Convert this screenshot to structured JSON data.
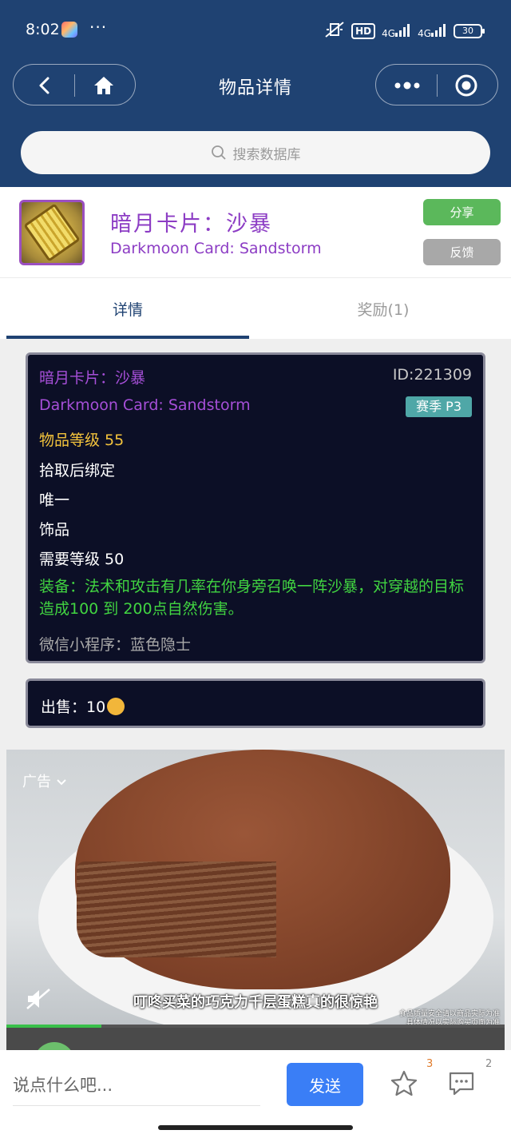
{
  "status_bar": {
    "time": "8:02",
    "more": "···",
    "hd": "HD",
    "signal1": "4G",
    "signal2": "4G",
    "battery": "30"
  },
  "nav": {
    "title": "物品详情"
  },
  "search": {
    "placeholder": "搜索数据库"
  },
  "item": {
    "name_cn": "暗月卡片：沙暴",
    "name_en": "Darkmoon Card: Sandstorm",
    "share_label": "分享",
    "feedback_label": "反馈",
    "border_color": "#9b4fc0",
    "name_color": "#8c3cc4"
  },
  "tabs": [
    {
      "label": "详情",
      "active": true
    },
    {
      "label": "奖励(1)",
      "active": false
    }
  ],
  "tooltip": {
    "name_cn": "暗月卡片：沙暴",
    "id": "ID:221309",
    "name_en": "Darkmoon Card: Sandstorm",
    "season": "赛季 P3",
    "item_level": "物品等级 55",
    "binding": "拾取后绑定",
    "unique": "唯一",
    "slot": "饰品",
    "required_level": "需要等级 50",
    "equip_text": "装备：法术和攻击有几率在你身旁召唤一阵沙暴，对穿越的目标造成100 到 200点自然伤害。",
    "credit": "微信小程序：蓝色隐士"
  },
  "sell": {
    "label": "出售：",
    "value": "10"
  },
  "ad": {
    "label": "广告",
    "caption": "叮咚买菜的巧克力千层蛋糕真的很惊艳",
    "fine_print_1": "食品质量安全请以商品实际为准",
    "fine_print_2": "具体情况以实际购买页面为准",
    "progress": 0.19
  },
  "bottom": {
    "comment_placeholder": "说点什么吧...",
    "send_label": "发送",
    "star_count": "3",
    "comment_count": "2"
  }
}
